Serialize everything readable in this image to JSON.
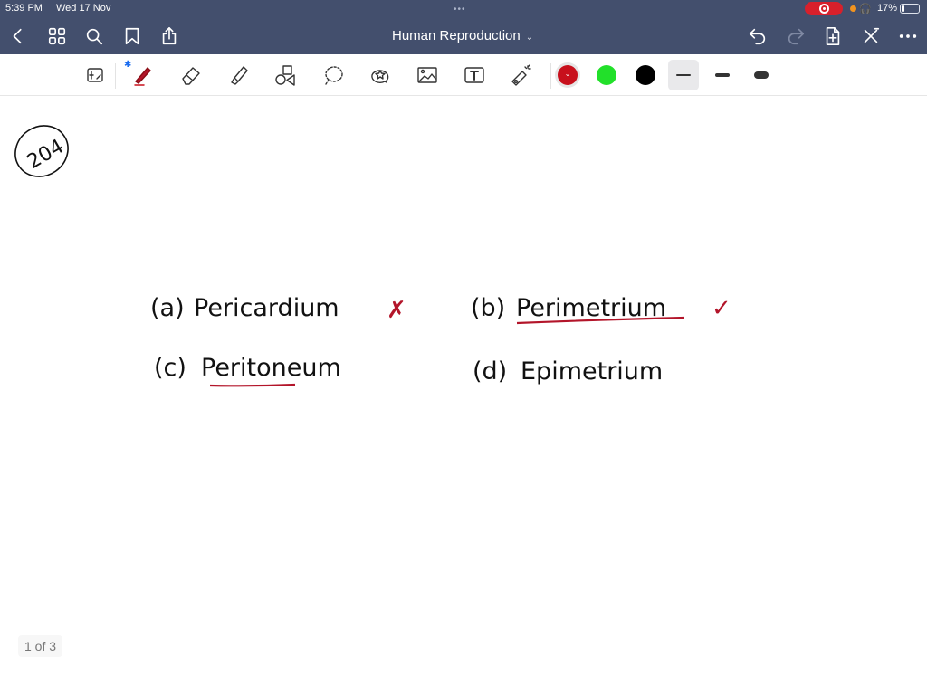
{
  "status_bar": {
    "time": "5:39 PM",
    "date": "Wed 17 Nov",
    "multitask_dots": "•••",
    "recording_icon": "screen-recording-icon",
    "headphones_icon": "headphones-icon",
    "battery_percent": "17%",
    "battery_level": 0.17
  },
  "nav": {
    "back_icon": "chevron-left-icon",
    "thumbnails_icon": "grid-icon",
    "search_icon": "search-icon",
    "bookmark_icon": "bookmark-icon",
    "share_icon": "share-icon",
    "document_title": "Human Reproduction",
    "title_chevron": "⌄",
    "undo_icon": "undo-icon",
    "redo_icon": "redo-icon",
    "add_page_icon": "add-page-icon",
    "close_pen_icon": "pen-off-icon",
    "more_icon": "more-icon"
  },
  "toolbar": {
    "tools": [
      "read-only-toggle",
      "pen",
      "eraser",
      "highlighter",
      "shapes",
      "lasso",
      "elements",
      "image",
      "text",
      "laser-pointer"
    ],
    "bluetooth_icon": "bluetooth-icon",
    "colors": [
      {
        "name": "red",
        "hex": "#c8101c",
        "selected": true
      },
      {
        "name": "green",
        "hex": "#22e02a",
        "selected": false
      },
      {
        "name": "black",
        "hex": "#000000",
        "selected": false
      }
    ],
    "thickness": [
      {
        "name": "thin",
        "selected": true
      },
      {
        "name": "medium",
        "selected": false
      },
      {
        "name": "thick",
        "selected": false
      }
    ]
  },
  "page": {
    "question_number": "204",
    "options": [
      {
        "label": "(a)",
        "text": "Pericardium",
        "mark": "✗",
        "mark_color": "#b3152a"
      },
      {
        "label": "(b)",
        "text": "Perimetrium",
        "mark": "✓",
        "mark_color": "#b3152a",
        "underlined": true
      },
      {
        "label": "(c)",
        "text": "Peritoneum",
        "underlined_partial": "Perito"
      },
      {
        "label": "(d)",
        "text": "Epimetrium"
      }
    ],
    "page_counter": "1 of 3"
  }
}
